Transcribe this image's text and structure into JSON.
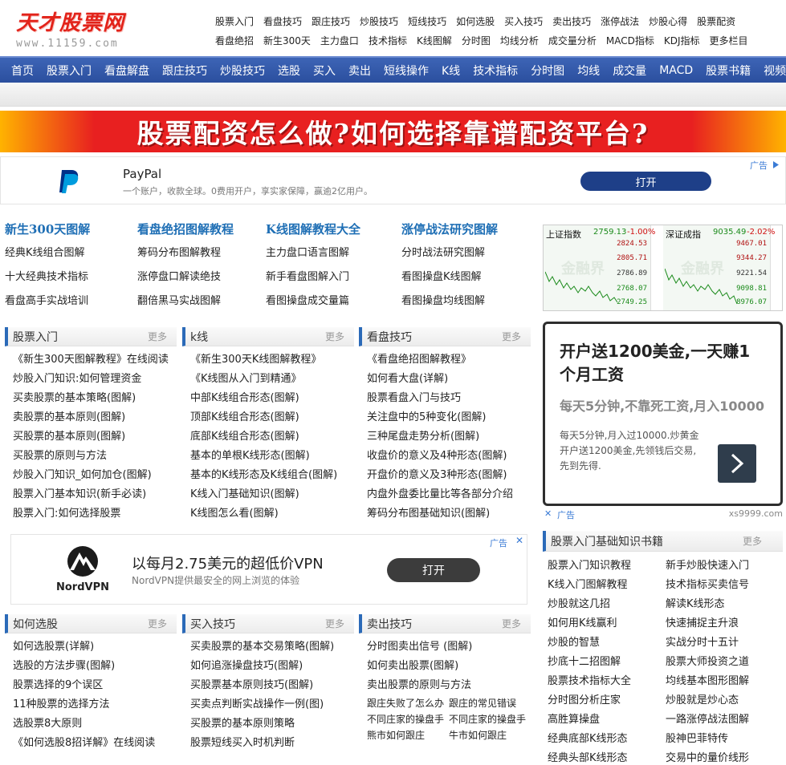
{
  "logo": {
    "title": "天才股票网",
    "url": "www.11159.com"
  },
  "toplinks": {
    "row1": [
      "股票入门",
      "看盘技巧",
      "跟庄技巧",
      "炒股技巧",
      "短线技巧",
      "如何选股",
      "买入技巧",
      "卖出技巧",
      "涨停战法",
      "炒股心得",
      "股票配资"
    ],
    "row2": [
      "看盘绝招",
      "新生300天",
      "主力盘口",
      "技术指标",
      "K线图解",
      "分时图",
      "均线分析",
      "成交量分析",
      "MACD指标",
      "KDJ指标",
      "更多栏目"
    ]
  },
  "nav": [
    "首页",
    "股票入门",
    "看盘解盘",
    "跟庄技巧",
    "炒股技巧",
    "选股",
    "买入",
    "卖出",
    "短线操作",
    "K线",
    "技术指标",
    "分时图",
    "均线",
    "成交量",
    "MACD",
    "股票书籍",
    "视频"
  ],
  "banner": {
    "text": "股票配资怎么做?如何选择靠谱配资平台?"
  },
  "ad_paypal": {
    "name": "PayPal",
    "desc": "一个账户，收款全球。0费用开户，享实家保障，赢逾2亿用户。",
    "open": "打开",
    "tag": "广告"
  },
  "featured": [
    {
      "head": "新生300天图解",
      "items": [
        "经典K线组合图解",
        "十大经典技术指标",
        "看盘高手实战培训"
      ]
    },
    {
      "head": "看盘绝招图解教程",
      "items": [
        "筹码分布图解教程",
        "涨停盘口解读绝技",
        "翻倍黑马实战图解"
      ]
    },
    {
      "head": "K线图解教程大全",
      "items": [
        "主力盘口语言图解",
        "新手看盘图解入门",
        "看图操盘成交量篇"
      ]
    },
    {
      "head": "涨停战法研究图解",
      "items": [
        "分时战法研究图解",
        "看图操盘K线图解",
        "看图操盘均线图解"
      ]
    }
  ],
  "market": {
    "left": {
      "name": "上证指数",
      "value": "2759.13",
      "change": "-1.00%",
      "axis": [
        "2824.53",
        "2805.71",
        "2786.89",
        "2768.07",
        "2749.25"
      ]
    },
    "right": {
      "name": "深证成指",
      "value": "9035.49",
      "change": "-2.02%",
      "axis": [
        "9467.01",
        "9344.27",
        "9221.54",
        "9098.81",
        "8976.07"
      ]
    },
    "watermark": "金融界"
  },
  "sections_top": [
    {
      "title": "股票入门",
      "more": "更多",
      "items": [
        "《新生300天图解教程》在线阅读",
        "炒股入门知识:如何管理资金",
        "买卖股票的基本策略(图解)",
        "卖股票的基本原则(图解)",
        "买股票的基本原则(图解)",
        "买股票的原则与方法",
        "炒股入门知识_如何加仓(图解)",
        "股票入门基本知识(新手必读)",
        "股票入门:如何选择股票"
      ]
    },
    {
      "title": "k线",
      "more": "更多",
      "items": [
        "《新生300天K线图解教程》",
        "《K线图从入门到精通》",
        "中部K线组合形态(图解)",
        "顶部K线组合形态(图解)",
        "底部K线组合形态(图解)",
        "基本的单根K线形态(图解)",
        "基本的K线形态及K线组合(图解)",
        "K线入门基础知识(图解)",
        "K线图怎么看(图解)"
      ]
    },
    {
      "title": "看盘技巧",
      "more": "更多",
      "items": [
        "《看盘绝招图解教程》",
        "如何看大盘(详解)",
        "股票看盘入门与技巧",
        "关注盘中的5种变化(图解)",
        "三种尾盘走势分析(图解)",
        "收盘价的意义及4种形态(图解)",
        "开盘价的意义及3种形态(图解)",
        "内盘外盘委比量比等各部分介绍",
        "筹码分布图基础知识(图解)"
      ]
    }
  ],
  "ad_right": {
    "headline": "开户送1200美金,一天赚1个月工资",
    "subhead": "每天5分钟,不靠死工资,月入10000",
    "body": "每天5分钟,月入过10000.炒黄金开户送1200美金,先领钱后交易,先到先得.",
    "foot_left": "广告",
    "foot_right": "xs9999.com"
  },
  "ad_nord": {
    "brand": "NordVPN",
    "title": "以每月2.75美元的超低价VPN",
    "desc": "NordVPN提供最安全的网上浏览的体验",
    "open": "打开",
    "tag": "广告"
  },
  "books": {
    "title": "股票入门基础知识书籍",
    "more": "更多",
    "items": [
      "股票入门知识教程",
      "新手炒股快速入门",
      "K线入门图解教程",
      "技术指标买卖信号",
      "炒股就这几招",
      "解读K线形态",
      "如何用K线赢利",
      "快速捕捉主升浪",
      "炒股的智慧",
      "实战分时十五计",
      "抄底十二招图解",
      "股票大师投资之道",
      "股票技术指标大全",
      "均线基本图形图解",
      "分时图分析庄家",
      "炒股就是炒心态",
      "高胜算操盘",
      "一路涨停战法图解",
      "经典底部K线形态",
      "股神巴菲特传",
      "经典头部K线形态",
      "交易中的量价线形"
    ]
  },
  "sections_bottom": [
    {
      "title": "如何选股",
      "more": "更多",
      "items": [
        "如何选股票(详解)",
        "选股的方法步骤(图解)",
        "股票选择的9个误区",
        "11种股票的选择方法",
        "选股票8大原则",
        "《如何选股8招详解》在线阅读"
      ]
    },
    {
      "title": "买入技巧",
      "more": "更多",
      "items": [
        "买卖股票的基本交易策略(图解)",
        "如何追涨操盘技巧(图解)",
        "买股票基本原则技巧(图解)",
        "买卖点判断实战操作一例(图)",
        "买股票的基本原则策略",
        "股票短线买入时机判断"
      ]
    },
    {
      "title": "卖出技巧",
      "more": "更多",
      "items": [
        "分时图卖出信号 (图解)",
        "如何卖出股票(图解)",
        "卖出股票的原则与方法"
      ],
      "pairs": [
        [
          "跟庄失败了怎么办",
          "跟庄的常见错误"
        ],
        [
          "不同庄家的操盘手",
          "不同庄家的操盘手"
        ],
        [
          "熊市如何跟庄",
          "牛市如何跟庄"
        ]
      ]
    }
  ],
  "colors": {
    "nav": "#2f55a5",
    "accent_blue": "#1f6fb5",
    "banner_red": "#e82020",
    "logo_red": "#e2231a"
  }
}
